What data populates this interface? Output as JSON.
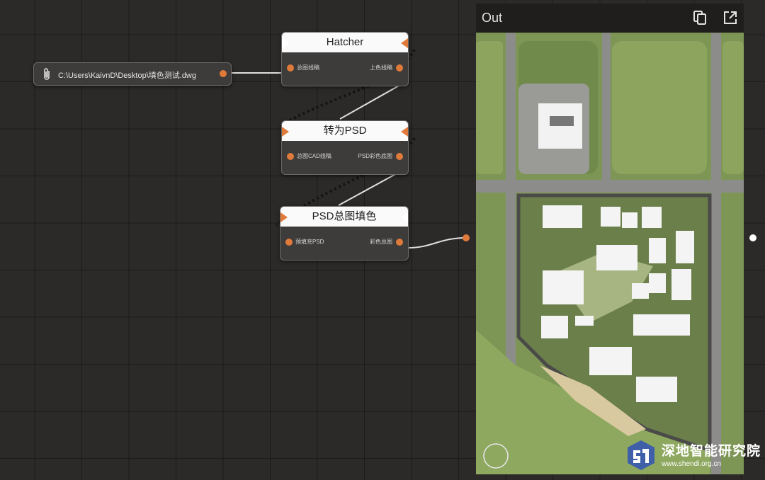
{
  "file_node": {
    "path": "C:\\Users\\KaivnD\\Desktop\\填色测试.dwg"
  },
  "nodes": [
    {
      "title": "Hatcher",
      "in_label": "总图线稿",
      "out_label": "上色线稿"
    },
    {
      "title": "转为PSD",
      "in_label": "总图CAD线稿",
      "out_label": "PSD彩色底图"
    },
    {
      "title": "PSD总图填色",
      "in_label": "预填充PSD",
      "out_label": "彩色总图"
    }
  ],
  "out_panel": {
    "title": "Out",
    "copy_icon": "copy-icon",
    "open_icon": "external-link-icon"
  },
  "watermark": {
    "brand": "深地智能研究院",
    "url": "www.shendi.org.cn"
  },
  "colors": {
    "port": "#e07a3a",
    "node_bg": "#3d3c3b",
    "title_bg": "#fafafa",
    "grass": "#7e9656",
    "road": "#8a8a88"
  }
}
